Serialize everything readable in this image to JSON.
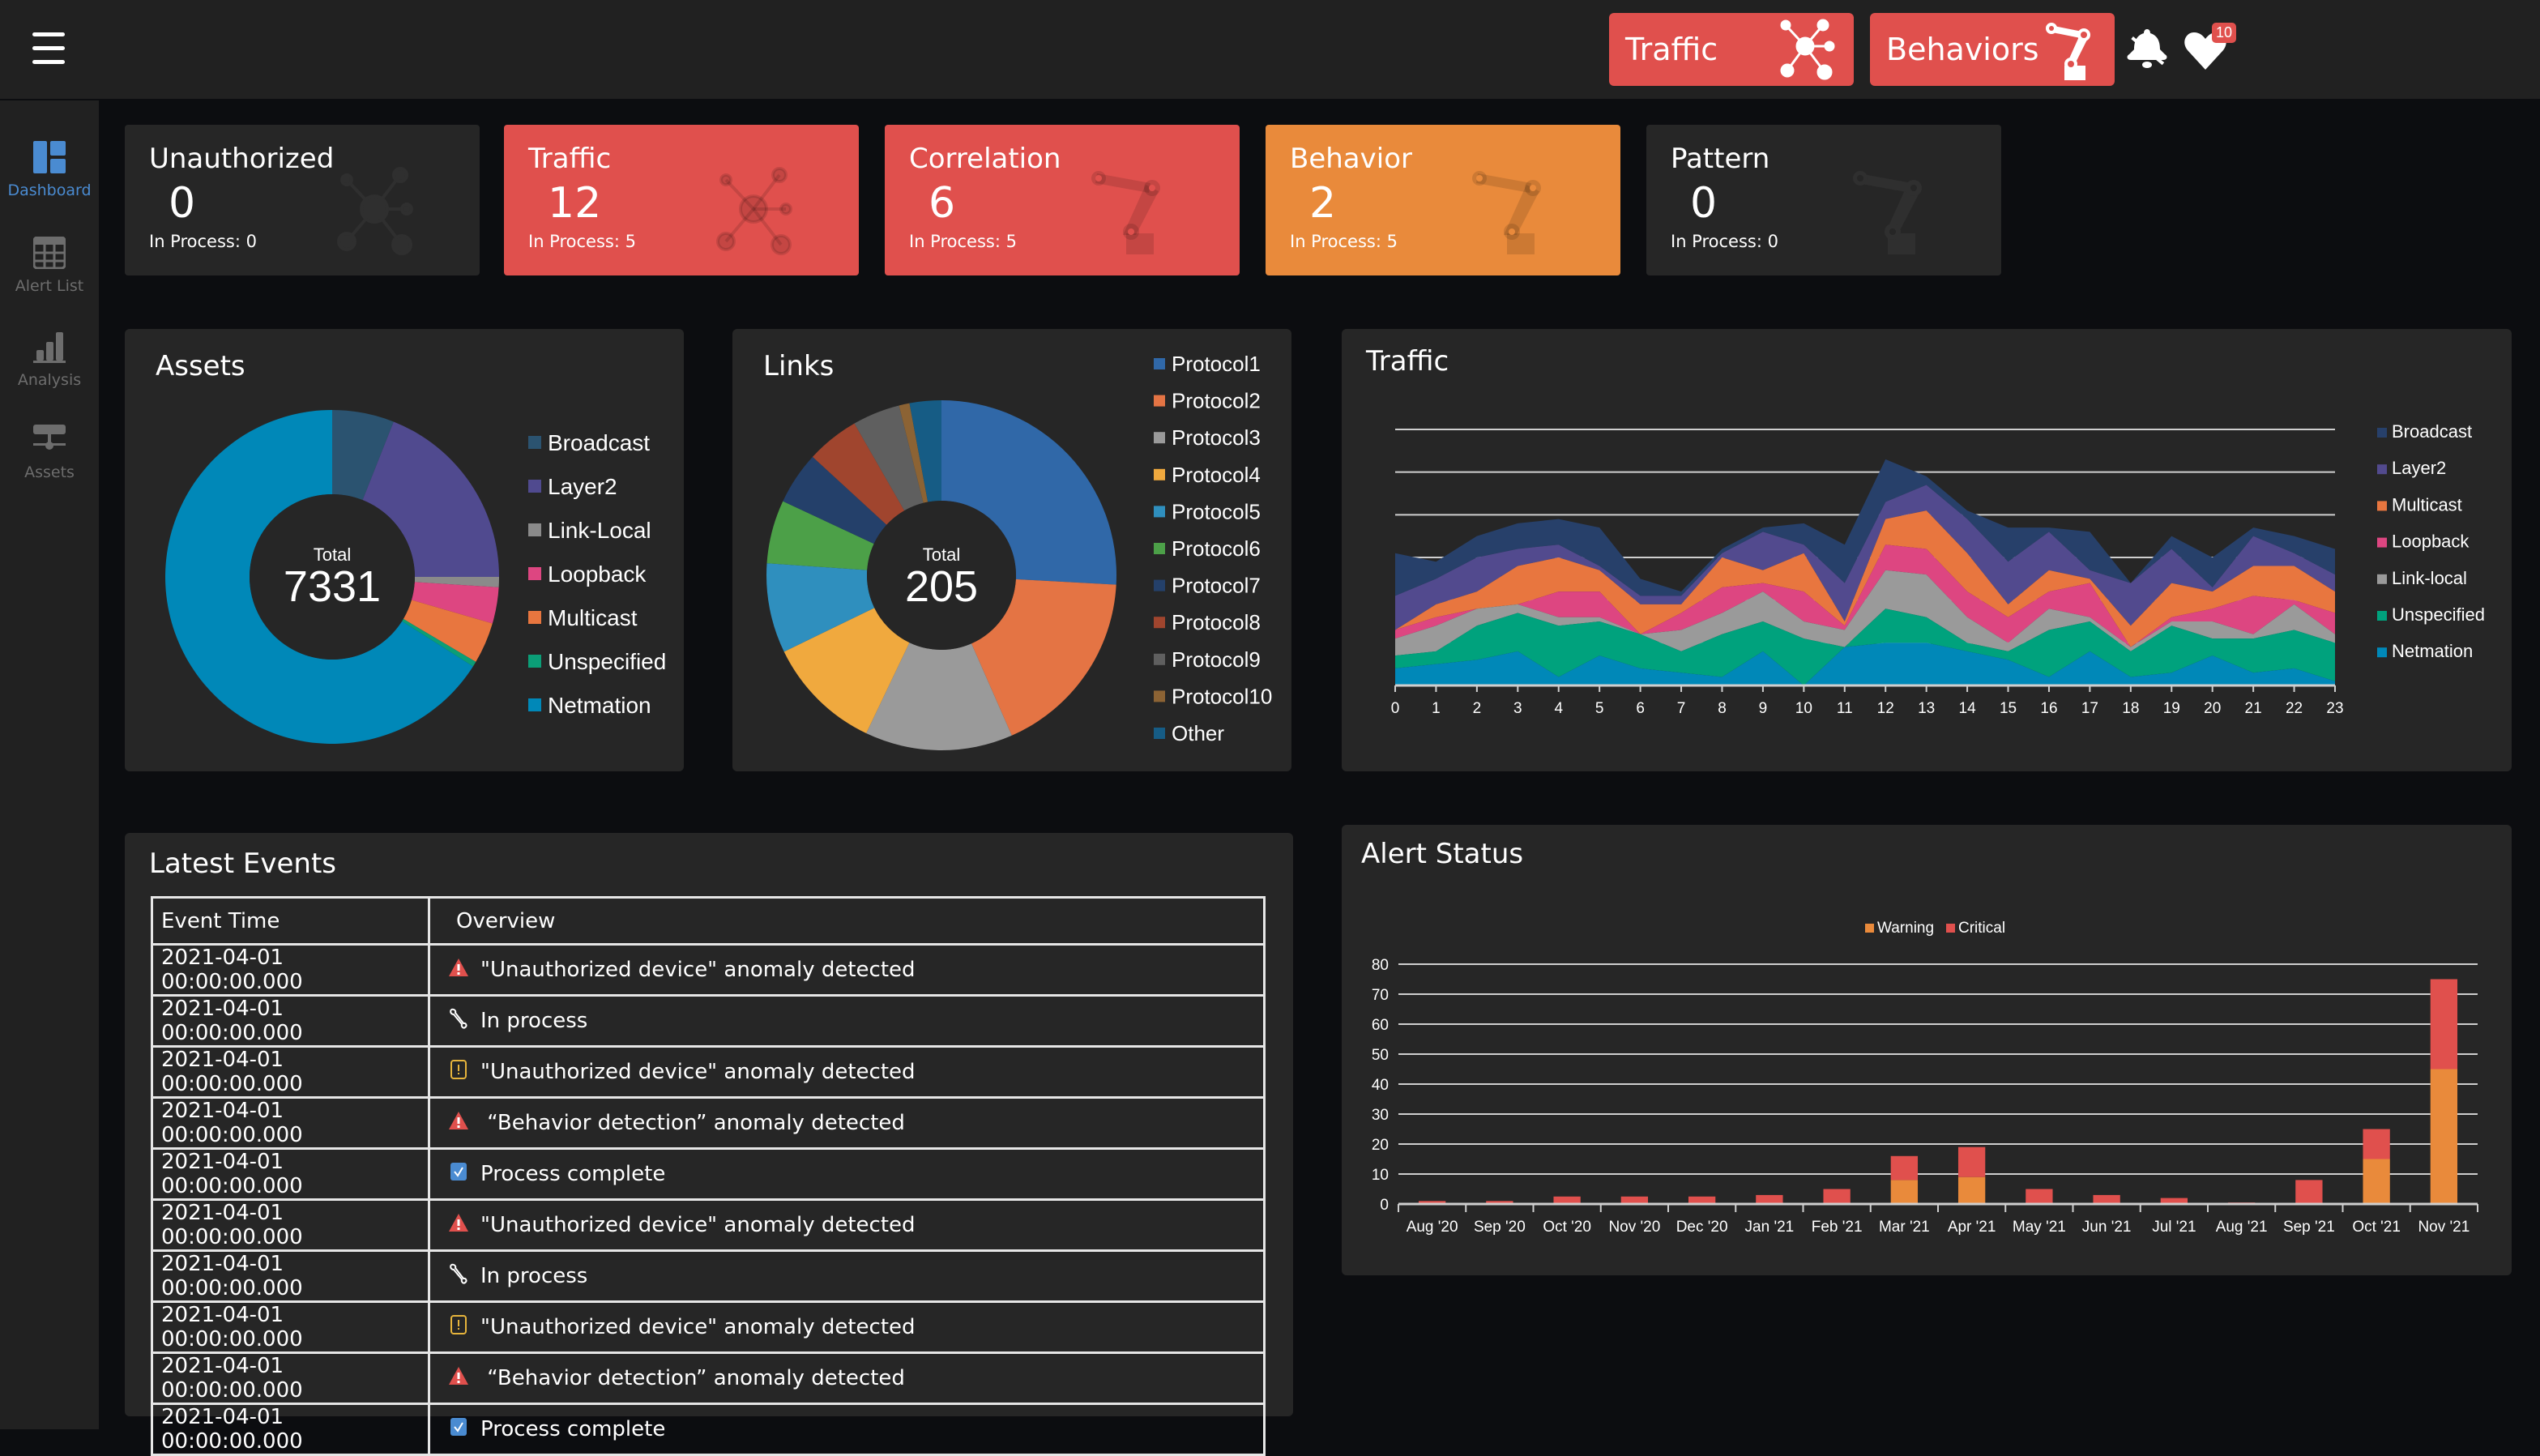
{
  "header": {
    "menu_icon": "hamburger-icon",
    "buttons": [
      {
        "label": "Traffic",
        "icon": "network-icon"
      },
      {
        "label": "Behaviors",
        "icon": "robot-arm-icon"
      }
    ],
    "bell_icon": "bell-slash-icon",
    "heart_icon": "heart-icon",
    "heart_badge": "10"
  },
  "sidebar": {
    "items": [
      {
        "label": "Dashboard",
        "icon": "dashboard-icon",
        "active": true
      },
      {
        "label": "Alert List",
        "icon": "table-icon",
        "active": false
      },
      {
        "label": "Analysis",
        "icon": "bar-chart-icon",
        "active": false
      },
      {
        "label": "Assets",
        "icon": "server-network-icon",
        "active": false
      }
    ]
  },
  "cards": [
    {
      "title": "Unauthorized",
      "count": "0",
      "sub": "In Process: 0",
      "color": "#262626",
      "icon": "network-icon"
    },
    {
      "title": "Traffic",
      "count": "12",
      "sub": "In Process: 5",
      "color": "#e0504d",
      "icon": "network-icon"
    },
    {
      "title": "Correlation",
      "count": "6",
      "sub": "In Process: 5",
      "color": "#e0504d",
      "icon": "robot-arm-icon"
    },
    {
      "title": "Behavior",
      "count": "2",
      "sub": "In Process: 5",
      "color": "#e98a3b",
      "icon": "robot-arm-icon"
    },
    {
      "title": "Pattern",
      "count": "0",
      "sub": "In Process: 0",
      "color": "#262626",
      "icon": "robot-arm-icon"
    }
  ],
  "assets": {
    "title": "Assets",
    "center_label": "Total",
    "center_value": "7331"
  },
  "links": {
    "title": "Links",
    "center_label": "Total",
    "center_value": "205"
  },
  "traffic": {
    "title": "Traffic"
  },
  "events": {
    "title": "Latest Events",
    "columns": [
      "Event Time",
      "Overview"
    ],
    "rows": [
      {
        "time": "2021-04-01 00:00:00.000",
        "icon": "alert-triangle-icon",
        "text": "\"Unauthorized device\" anomaly detected"
      },
      {
        "time": "2021-04-01 00:00:00.000",
        "icon": "wrench-icon",
        "text": "In process"
      },
      {
        "time": "2021-04-01 00:00:00.000",
        "icon": "exclamation-box-icon",
        "text": "\"Unauthorized device\" anomaly detected"
      },
      {
        "time": "2021-04-01 00:00:00.000",
        "icon": "alert-triangle-icon",
        "text": " “Behavior detection” anomaly detected"
      },
      {
        "time": "2021-04-01 00:00:00.000",
        "icon": "checkbox-icon",
        "text": "Process complete"
      },
      {
        "time": "2021-04-01 00:00:00.000",
        "icon": "alert-triangle-icon",
        "text": "\"Unauthorized device\" anomaly detected"
      },
      {
        "time": "2021-04-01 00:00:00.000",
        "icon": "wrench-icon",
        "text": "In process"
      },
      {
        "time": "2021-04-01 00:00:00.000",
        "icon": "exclamation-box-icon",
        "text": "\"Unauthorized device\" anomaly detected"
      },
      {
        "time": "2021-04-01 00:00:00.000",
        "icon": "alert-triangle-icon",
        "text": " “Behavior detection” anomaly detected"
      },
      {
        "time": "2021-04-01 00:00:00.000",
        "icon": "checkbox-icon",
        "text": "Process complete"
      }
    ]
  },
  "alert_status": {
    "title": "Alert Status"
  },
  "chart_data": [
    {
      "id": "assets",
      "type": "pie",
      "title": "Assets",
      "donut": true,
      "total": 7331,
      "legend_position": "right",
      "labels": [
        "Broadcast",
        "Layer2",
        "Link-Local",
        "Loopback",
        "Multicast",
        "Unspecified",
        "Netmation"
      ],
      "values": [
        440,
        1393,
        73,
        257,
        293,
        37,
        4838
      ],
      "colors": [
        "#2b5370",
        "#504a8f",
        "#8a8a8a",
        "#dd4681",
        "#e8763f",
        "#0b9e77",
        "#0088b8"
      ]
    },
    {
      "id": "links",
      "type": "pie",
      "title": "Links",
      "donut": true,
      "total": 205,
      "legend_position": "right",
      "labels": [
        "Protocol1",
        "Protocol2",
        "Protocol3",
        "Protocol4",
        "Protocol5",
        "Protocol6",
        "Protocol7",
        "Protocol8",
        "Protocol9",
        "Protocol10",
        "Other"
      ],
      "values": [
        53,
        36,
        28,
        22,
        17,
        12,
        10,
        10,
        9,
        2,
        6
      ],
      "colors": [
        "#3068a8",
        "#e47444",
        "#9a9a9a",
        "#f0a93e",
        "#2f8fbe",
        "#4ca048",
        "#24406a",
        "#a0452e",
        "#5f5f5f",
        "#8c6334",
        "#165c85"
      ]
    },
    {
      "id": "traffic",
      "type": "area",
      "stacked": true,
      "title": "Traffic",
      "xlabel": "",
      "ylabel": "",
      "x": [
        0,
        1,
        2,
        3,
        4,
        5,
        6,
        7,
        8,
        9,
        10,
        11,
        12,
        13,
        14,
        15,
        16,
        17,
        18,
        19,
        20,
        21,
        22,
        23
      ],
      "ylim": [
        0,
        60
      ],
      "y_ticks_shown": false,
      "grid": true,
      "legend_position": "right",
      "series": [
        {
          "name": "Netmation",
          "color": "#0088b8",
          "values": [
            4,
            5,
            6,
            8,
            2,
            7,
            4,
            3,
            2,
            8,
            0,
            9,
            10,
            10,
            8,
            6,
            2,
            8,
            2,
            3,
            7,
            3,
            4,
            1
          ]
        },
        {
          "name": "Unspecified",
          "color": "#00a27d",
          "values": [
            3,
            3,
            8,
            9,
            12,
            8,
            8,
            5,
            10,
            7,
            11,
            0,
            8,
            6,
            2,
            2,
            11,
            7,
            6,
            11,
            4,
            8,
            9,
            9
          ]
        },
        {
          "name": "Link-local",
          "color": "#9a9a9a",
          "values": [
            4,
            6,
            4,
            2,
            2,
            1,
            0,
            5,
            5,
            7,
            4,
            4,
            9,
            10,
            6,
            2,
            5,
            1,
            1,
            1,
            4,
            1,
            6,
            2
          ]
        },
        {
          "name": "Loopback",
          "color": "#dd4681",
          "values": [
            2,
            2,
            0,
            0,
            6,
            6,
            0,
            4,
            6,
            2,
            7,
            1,
            6,
            6,
            6,
            6,
            4,
            8,
            0,
            1,
            3,
            9,
            1,
            5
          ]
        },
        {
          "name": "Multicast",
          "color": "#e8763f",
          "values": [
            0,
            3,
            4,
            9,
            8,
            5,
            7,
            2,
            7,
            3,
            9,
            1,
            6,
            9,
            9,
            3,
            5,
            1,
            5,
            8,
            4,
            7,
            8,
            5
          ]
        },
        {
          "name": "Layer2",
          "color": "#524a8e",
          "values": [
            8,
            6,
            8,
            4,
            3,
            1,
            2,
            2,
            1,
            9,
            2,
            9,
            4,
            6,
            8,
            10,
            9,
            2,
            10,
            8,
            1,
            7,
            3,
            4
          ]
        },
        {
          "name": "Broadcast",
          "color": "#27406a",
          "values": [
            10,
            4,
            5,
            6,
            6,
            9,
            4,
            1,
            1,
            1,
            5,
            9,
            10,
            2,
            2,
            8,
            1,
            9,
            0,
            3,
            7,
            2,
            4,
            6
          ]
        }
      ]
    },
    {
      "id": "alert_status",
      "type": "bar",
      "stacked": true,
      "title": "Alert Status",
      "xlabel": "",
      "ylabel": "",
      "categories": [
        "Aug '20",
        "Sep '20",
        "Oct '20",
        "Nov '20",
        "Dec '20",
        "Jan '21",
        "Feb '21",
        "Mar '21",
        "Apr '21",
        "May '21",
        "Jun '21",
        "Jul '21",
        "Aug '21",
        "Sep '21",
        "Oct '21",
        "Nov '21"
      ],
      "ylim": [
        0,
        80
      ],
      "y_ticks": [
        0,
        10,
        20,
        30,
        40,
        50,
        60,
        70,
        80
      ],
      "grid": true,
      "legend_position": "top-center",
      "series": [
        {
          "name": "Warning",
          "color": "#e98a3b",
          "values": [
            0,
            0,
            0,
            0,
            0,
            0,
            0,
            8,
            9,
            0,
            0,
            0,
            0,
            0,
            15,
            45
          ]
        },
        {
          "name": "Critical",
          "color": "#e0504d",
          "values": [
            1,
            1,
            2.5,
            2.5,
            2.5,
            3,
            5,
            8,
            10,
            5,
            3,
            2,
            0.5,
            8,
            10,
            30
          ]
        }
      ]
    }
  ]
}
